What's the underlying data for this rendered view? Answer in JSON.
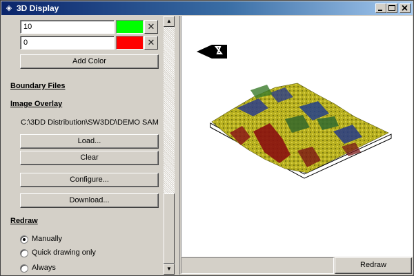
{
  "window": {
    "title": "3D Display",
    "icon": "diamond-app-icon"
  },
  "color_levels": [
    {
      "value": "10",
      "color": "#00ff00"
    },
    {
      "value": "0",
      "color": "#ff0000"
    }
  ],
  "buttons": {
    "add_color": "Add Color",
    "load": "Load...",
    "clear": "Clear",
    "configure": "Configure...",
    "download": "Download...",
    "redraw": "Redraw"
  },
  "sections": {
    "boundary_files": "Boundary Files",
    "image_overlay": "Image Overlay",
    "redraw": "Redraw"
  },
  "overlay_path": "C:\\3DD Distribution\\SW3DD\\DEMO SAM",
  "redraw_options": [
    {
      "label": "Manually",
      "selected": true
    },
    {
      "label": "Quick drawing only",
      "selected": false
    },
    {
      "label": "Always",
      "selected": false
    }
  ],
  "colors": {
    "title_start": "#0a246a",
    "face": "#d4d0c8",
    "view_bg": "#ffffff"
  }
}
